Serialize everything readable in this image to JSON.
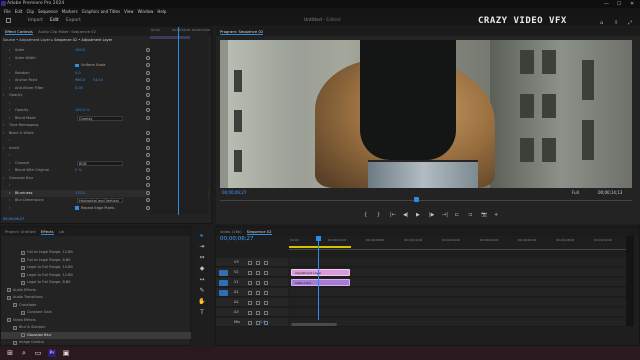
{
  "window": {
    "title": "Adobe Premiere Pro 2024",
    "controls": [
      "—",
      "☐",
      "✕"
    ]
  },
  "menu": [
    "File",
    "Edit",
    "Clip",
    "Sequence",
    "Markers",
    "Graphics and Titles",
    "View",
    "Window",
    "Help"
  ],
  "workspace": {
    "tabs": [
      "Import",
      "Edit",
      "Export"
    ],
    "active": "Edit",
    "document_title": "Untitled",
    "document_status": "- Edited"
  },
  "watermark": "CRAZY VIDEO VFX",
  "effect_controls": {
    "tabs": [
      "Effect Controls",
      "Audio Clip Mixer: Sequence 02"
    ],
    "source": "Source • Adjustment Layer",
    "sequence": "Sequence 02 • Adjustment Layer",
    "ruler": [
      "00:00",
      "00:00:05:00",
      "00:00:10:00"
    ],
    "rows": [
      {
        "label": "Scale",
        "indent": 12,
        "value": "100.0",
        "reset": true
      },
      {
        "label": "Scale Width",
        "indent": 12,
        "value": "",
        "reset": true
      },
      {
        "label": "",
        "indent": 12,
        "check": "Uniform Scale",
        "reset": true
      },
      {
        "label": "Rotation",
        "indent": 12,
        "value": "0.0",
        "reset": true
      },
      {
        "label": "Anchor Point",
        "indent": 12,
        "value": "960.0",
        "value2": "540.0",
        "reset": true
      },
      {
        "label": "Anti-flicker Filter",
        "indent": 12,
        "value": "0.00",
        "reset": true
      },
      {
        "label": "Opacity",
        "indent": 6,
        "value": "",
        "reset": true
      },
      {
        "label": "",
        "indent": 12,
        "value": "",
        "reset": true
      },
      {
        "label": "Opacity",
        "indent": 12,
        "value": "100.0 %",
        "reset": true
      },
      {
        "label": "Blend Mode",
        "indent": 12,
        "select": "Overlay",
        "reset": true
      },
      {
        "label": "Time Remapping",
        "indent": 6,
        "value": "",
        "reset": false
      },
      {
        "label": "Black & White",
        "indent": 6,
        "value": "",
        "reset": true
      },
      {
        "label": "",
        "indent": 12,
        "value": "",
        "reset": true
      },
      {
        "label": "Invert",
        "indent": 6,
        "value": "",
        "reset": true
      },
      {
        "label": "",
        "indent": 12,
        "value": "",
        "reset": true
      },
      {
        "label": "Channel",
        "indent": 12,
        "select": "RGB",
        "reset": true
      },
      {
        "label": "Blend With Original",
        "indent": 12,
        "value": "0 %",
        "reset": true
      },
      {
        "label": "Gaussian Blur",
        "indent": 6,
        "value": "",
        "reset": true
      },
      {
        "label": "",
        "indent": 12,
        "value": "",
        "reset": true
      },
      {
        "label": "Blurriness",
        "indent": 12,
        "value": "170.0",
        "reset": true,
        "highlight": true
      },
      {
        "label": "Blur Dimensions",
        "indent": 12,
        "select": "Horizontal and Vertical",
        "reset": true
      },
      {
        "label": "",
        "indent": 12,
        "check": "Repeat Edge Pixels",
        "reset": true
      }
    ],
    "current_time": "00;00;06;27"
  },
  "program": {
    "title": "Program: Sequence 02",
    "timecode": "00;00;06;27",
    "fit": "Full",
    "duration": "00;00;14;13",
    "transport_icons": [
      "{",
      "}",
      "|←",
      "◀|",
      "▶",
      "|▶",
      "→|",
      "⊏",
      "⊐",
      "📷",
      "+"
    ]
  },
  "effects_panel": {
    "tabs": [
      "Project: Untitled",
      "Effects",
      "Lib"
    ],
    "active": "Effects",
    "rows": [
      {
        "label": "Full to Legal Range, 12-Bit",
        "indent": 20,
        "selected": false
      },
      {
        "label": "Full to Legal Range, 8-Bit",
        "indent": 20,
        "selected": false
      },
      {
        "label": "Legal to Full Range, 10-Bit",
        "indent": 20,
        "selected": false
      },
      {
        "label": "Legal to Full Range, 12-Bit",
        "indent": 20,
        "selected": false
      },
      {
        "label": "Legal to Full Range, 8-Bit",
        "indent": 20,
        "selected": false
      },
      {
        "label": "Audio Effects",
        "indent": 6,
        "selected": false
      },
      {
        "label": "Audio Transitions",
        "indent": 6,
        "selected": false
      },
      {
        "label": "Crossfade",
        "indent": 12,
        "selected": false
      },
      {
        "label": "Constant Gain",
        "indent": 20,
        "selected": false
      },
      {
        "label": "Video Effects",
        "indent": 6,
        "selected": false
      },
      {
        "label": "Blur & Sharpen",
        "indent": 12,
        "selected": false
      },
      {
        "label": "Gaussian Blur",
        "indent": 20,
        "selected": true
      },
      {
        "label": "Image Control",
        "indent": 12,
        "selected": false
      }
    ]
  },
  "timeline": {
    "tabs": [
      "video (16k)",
      "Sequence 02"
    ],
    "timecode": "00;00;06;27",
    "ruler": [
      "00;00",
      "00;00;04;00",
      "00;00;08;00",
      "00;00;12;00",
      "00;00;16;00",
      "00;00;20;00",
      "00;00;24;00",
      "00;00;28;00",
      "00;00;32;00"
    ],
    "tracks": [
      {
        "name": "V3",
        "patch": false
      },
      {
        "name": "V2",
        "patch": true
      },
      {
        "name": "V1",
        "patch": true
      },
      {
        "name": "A1",
        "patch": true
      },
      {
        "name": "A2",
        "patch": false
      },
      {
        "name": "A3",
        "patch": false
      },
      {
        "name": "Mix",
        "patch": false
      }
    ],
    "clips": [
      {
        "label": "Adjustment Layer",
        "track": 1,
        "type": "adj"
      },
      {
        "label": "video.mp4",
        "track": 2,
        "type": "vid"
      }
    ],
    "mix_value": "0.0"
  },
  "tools": [
    "▸",
    "⇥",
    "⇔",
    "◆",
    "↔",
    "✎",
    "✋",
    "T"
  ],
  "taskbar": [
    "⊞",
    "⌕",
    "▭",
    "Pr",
    "▣"
  ]
}
